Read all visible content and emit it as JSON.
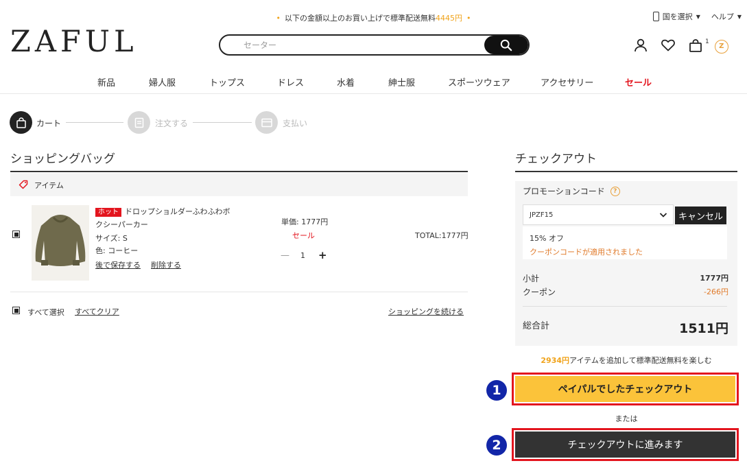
{
  "banner": {
    "promo_prefix": "以下の金額以上のお買い上げで標準配送無料",
    "promo_amount": "4445円",
    "country_label": "国を選択",
    "help_label": "ヘルプ"
  },
  "header": {
    "logo": "ZAFUL",
    "search_placeholder": "セーター",
    "cart_count": "1",
    "coin_label": "Z"
  },
  "nav": {
    "items": [
      "新品",
      "婦人服",
      "トップス",
      "ドレス",
      "水着",
      "紳士服",
      "スポーツウェア",
      "アクセサリー",
      "セール"
    ]
  },
  "steps": {
    "labels": [
      "カート",
      "注文する",
      "支払い"
    ]
  },
  "bag": {
    "title": "ショッピングバッグ",
    "item_header": "アイテム",
    "item": {
      "badge": "ホット",
      "name_line1": "ドロップショルダーふわふわボ",
      "name_line2": "クシーパーカー",
      "size": "サイズ: S",
      "color": "色: コーヒー",
      "save_later": "後で保存する",
      "remove": "削除する",
      "unit_price": "単価: 1777円",
      "sale": "セール",
      "quantity": "1",
      "total": "TOTAL:1777円"
    },
    "select_all": "すべて選択",
    "clear_all": "すべてクリア",
    "continue_shopping": "ショッピングを続ける"
  },
  "checkout": {
    "title": "チェックアウト",
    "promo_label": "プロモーションコード",
    "promo_code": "JPZF15",
    "cancel_label": "キャンセル",
    "discount_label": "15% オフ",
    "coupon_applied": "クーポンコードが適用されました",
    "subtotal_label": "小計",
    "subtotal_value": "1777円",
    "coupon_label": "クーポン",
    "coupon_value": "-266円",
    "grand_total_label": "総合計",
    "grand_total_value": "1511円",
    "shipping_amount": "2934円",
    "shipping_note": "アイテムを追加して標準配送無料を楽しむ",
    "paypal_label": "ペイパルでしたチェックアウト",
    "or_label": "または",
    "proceed_label": "チェックアウトに進みます",
    "marker1": "1",
    "marker2": "2"
  },
  "colors": {
    "accent_orange": "#f0a31b",
    "sale_red": "#e3151e",
    "paypal_yellow": "#fbc33a",
    "dark": "#333333",
    "marker_blue": "#1226a8"
  }
}
